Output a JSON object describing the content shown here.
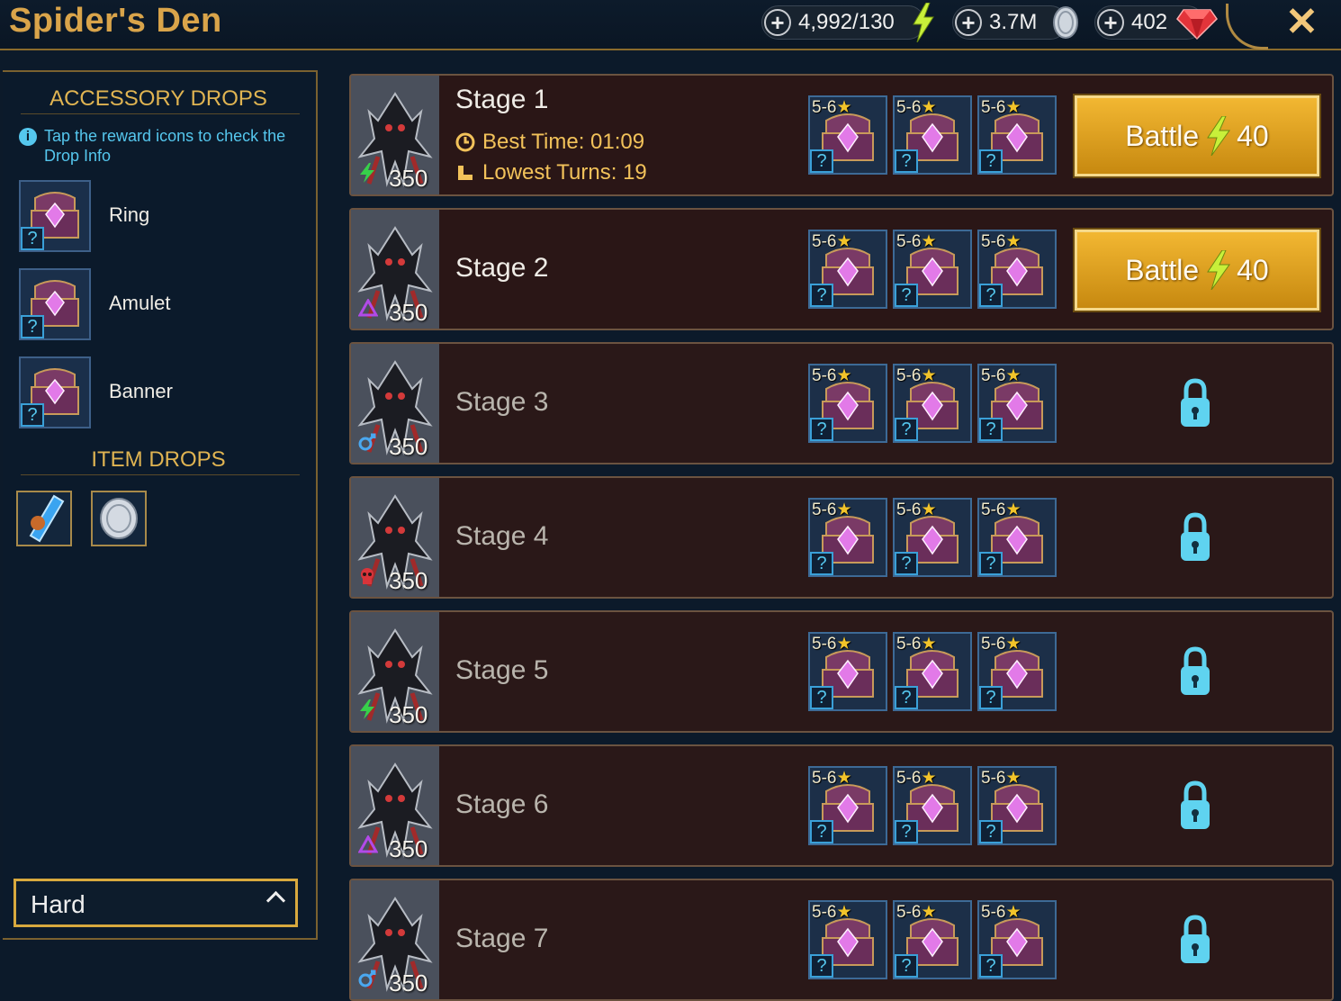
{
  "header": {
    "title": "Spider's Den",
    "energy": "4,992/130",
    "silver": "3.7M",
    "gems": "402",
    "icons": [
      "plus-icon",
      "energy-bolt-icon",
      "silver-coin-icon",
      "gem-icon",
      "close-icon"
    ]
  },
  "sidebar": {
    "accessory_title": "ACCESSORY DROPS",
    "tip": "Tap the reward icons to check the Drop Info",
    "accessories": [
      {
        "label": "Ring",
        "q": "?"
      },
      {
        "label": "Amulet",
        "q": "?"
      },
      {
        "label": "Banner",
        "q": "?"
      }
    ],
    "item_title": "ITEM DROPS",
    "items": [
      "champion-shard-icon",
      "silver-coin-icon"
    ],
    "difficulty": "Hard"
  },
  "stages": [
    {
      "name": "Stage 1",
      "power": "350",
      "affinity": "magic",
      "best_time": "Best Time: 01:09",
      "lowest_turns": "Lowest Turns: 19",
      "locked": false,
      "battle_label": "Battle",
      "energy_cost": "40"
    },
    {
      "name": "Stage 2",
      "power": "350",
      "affinity": "void",
      "locked": false,
      "battle_label": "Battle",
      "energy_cost": "40"
    },
    {
      "name": "Stage 3",
      "power": "350",
      "affinity": "force",
      "locked": true
    },
    {
      "name": "Stage 4",
      "power": "350",
      "affinity": "spirit",
      "locked": true
    },
    {
      "name": "Stage 5",
      "power": "350",
      "affinity": "magic",
      "locked": true
    },
    {
      "name": "Stage 6",
      "power": "350",
      "affinity": "void",
      "locked": true
    },
    {
      "name": "Stage 7",
      "power": "350",
      "affinity": "force",
      "locked": true
    }
  ],
  "drop": {
    "rank": "5-6",
    "star": "★",
    "q": "?"
  },
  "colors": {
    "accent": "#d9a44a",
    "tip": "#55c7ee",
    "battle": "#e9a623",
    "lock": "#5fd3f0"
  }
}
